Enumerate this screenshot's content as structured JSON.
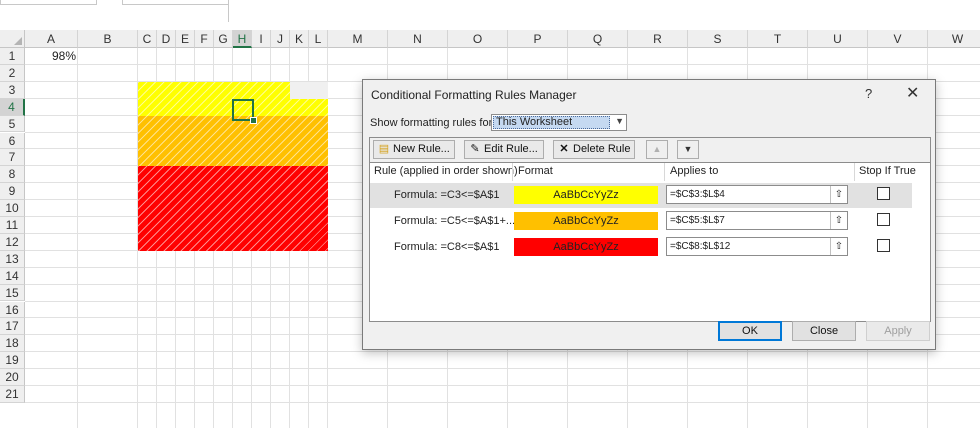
{
  "sheet": {
    "columns": [
      "A",
      "B",
      "C",
      "D",
      "E",
      "F",
      "G",
      "H",
      "I",
      "J",
      "K",
      "L",
      "M",
      "N",
      "O",
      "P",
      "Q",
      "R",
      "S",
      "T",
      "U",
      "V",
      "W"
    ],
    "active_column": "H",
    "rows": [
      "1",
      "2",
      "3",
      "4",
      "5",
      "6",
      "7",
      "8",
      "9",
      "10",
      "11",
      "12",
      "13",
      "14",
      "15",
      "16",
      "17",
      "18",
      "19",
      "20",
      "21"
    ],
    "active_row": "4",
    "cell_A1": "98%",
    "fill_colors": {
      "yellow": "#ffff00",
      "orange": "#ffc000",
      "red": "#ff0000",
      "empty_cell": "#f0f0f0"
    }
  },
  "dialog": {
    "title": "Conditional Formatting Rules Manager",
    "help": "?",
    "close": "✕",
    "show_rules_label": "Show formatting rules for:",
    "show_rules_value": "This Worksheet",
    "toolbar": {
      "new_rule": "New Rule...",
      "edit_rule": "Edit Rule...",
      "delete_rule": "Delete Rule",
      "move_up": "▲",
      "move_down": "▼"
    },
    "headers": {
      "rule": "Rule (applied in order shown)",
      "format": "Format",
      "applies_to": "Applies to",
      "stop_if_true": "Stop If True"
    },
    "rules": [
      {
        "formula": "Formula: =C3<=$A$1",
        "preview": "AaBbCcYyZz",
        "color": "#ffff00",
        "applies_to": "=$C$3:$L$4",
        "stop_if_true": false
      },
      {
        "formula": "Formula: =C5<=$A$1+...",
        "preview": "AaBbCcYyZz",
        "color": "#ffc000",
        "applies_to": "=$C$5:$L$7",
        "stop_if_true": false
      },
      {
        "formula": "Formula: =C8<=$A$1",
        "preview": "AaBbCcYyZz",
        "color": "#ff0000",
        "applies_to": "=$C$8:$L$12",
        "stop_if_true": false
      }
    ],
    "buttons": {
      "ok": "OK",
      "close": "Close",
      "apply": "Apply"
    }
  }
}
